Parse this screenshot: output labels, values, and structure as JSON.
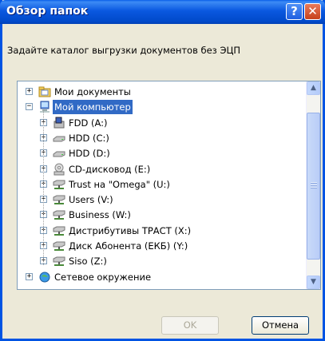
{
  "dialog": {
    "title": "Обзор папок",
    "help_glyph": "?",
    "close_glyph": "✕",
    "prompt": "Задайте каталог выгрузки документов без ЭЦП"
  },
  "tree": {
    "items": [
      {
        "label": "Мои документы",
        "icon": "my-documents-icon",
        "expander": "+"
      },
      {
        "label": "Мой компьютер",
        "icon": "my-computer-icon",
        "expander": "−",
        "selected": true
      },
      {
        "label": "FDD (A:)",
        "icon": "floppy-drive-icon",
        "expander": "+"
      },
      {
        "label": "HDD (C:)",
        "icon": "hard-drive-icon",
        "expander": "+"
      },
      {
        "label": "HDD (D:)",
        "icon": "hard-drive-icon",
        "expander": "+"
      },
      {
        "label": "CD-дисковод (E:)",
        "icon": "cd-drive-icon",
        "expander": "+"
      },
      {
        "label": "Trust на \"Omega\" (U:)",
        "icon": "network-drive-icon",
        "expander": "+"
      },
      {
        "label": "Users (V:)",
        "icon": "network-drive-icon",
        "expander": "+"
      },
      {
        "label": "Business (W:)",
        "icon": "network-drive-icon",
        "expander": "+"
      },
      {
        "label": "Дистрибутивы ТРАСТ (X:)",
        "icon": "network-drive-icon",
        "expander": "+"
      },
      {
        "label": "Диск Абонента (ЕКБ) (Y:)",
        "icon": "network-drive-icon",
        "expander": "+"
      },
      {
        "label": "Siso (Z:)",
        "icon": "network-drive-icon",
        "expander": "+"
      },
      {
        "label": "Сетевое окружение",
        "icon": "network-places-icon",
        "expander": "+"
      }
    ]
  },
  "scrollbar": {
    "up": "▲",
    "down": "▼"
  },
  "buttons": {
    "ok_label": "OK",
    "cancel_label": "Отмена"
  },
  "colors": {
    "title_bar": "#0054e3",
    "selection": "#316ac5",
    "dialog_bg": "#ece9d8"
  }
}
